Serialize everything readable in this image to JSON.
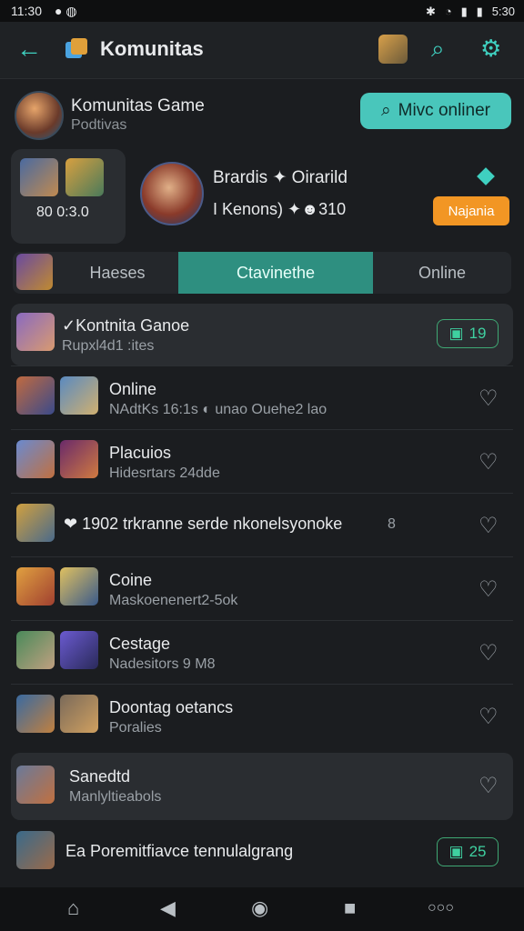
{
  "status": {
    "time": "11:30",
    "right_time": "5:30"
  },
  "appbar": {
    "title": "Komunitas",
    "back_icon": "arrow-left-icon",
    "search_icon": "search-icon",
    "settings_icon": "gear-icon"
  },
  "header": {
    "name": "Komunitas Game",
    "subtitle": "Podtivas",
    "button_label": "Mivc onliner"
  },
  "left_card": {
    "score": "80  0:3.0"
  },
  "profile": {
    "name": "Brardis ✦ Oirarild",
    "stats": "I Kenons)  ✦☻310",
    "badge": "Najania"
  },
  "tabs": [
    {
      "label": "Haeses"
    },
    {
      "label": "Ctavinethe"
    },
    {
      "label": "Online"
    }
  ],
  "rows": [
    {
      "title": "✓Kontnita Ganoe",
      "subtitle": "Rupxl4d1 :ites",
      "pill": "19"
    },
    {
      "title": "Online",
      "subtitle": "NAdtKs 16:1s  ◐ unao Ouehe2 lao"
    },
    {
      "title": "Placuios",
      "subtitle": "Hidesrtars 24dde"
    },
    {
      "title": "❤ 1902 trkranne serde nkonelsyonoke",
      "extra": "8"
    },
    {
      "title": "Coine",
      "subtitle": "Maskoenenert2-5ok"
    },
    {
      "title": "Cestage",
      "subtitle": "Nadesitors  9 M8"
    },
    {
      "title": "Doontag oetancs",
      "subtitle": "Poralies"
    },
    {
      "title": "Sanedtd",
      "subtitle": "Manlyltieabols"
    },
    {
      "title": "Ea Poremitfiavce tennulalgrang",
      "pill": "25"
    }
  ]
}
